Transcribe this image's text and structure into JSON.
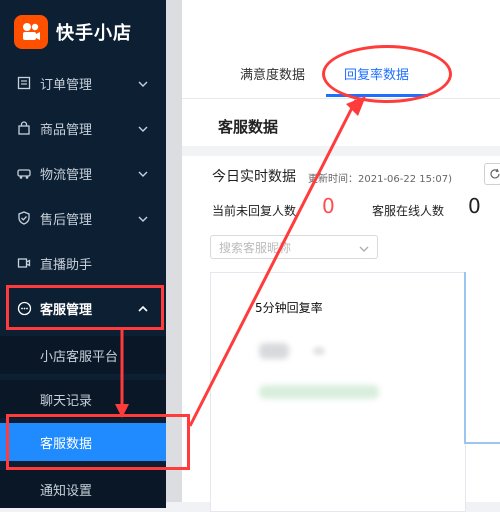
{
  "brand": {
    "name": "快手小店",
    "logo_icon": "kuaishou-logo-icon",
    "accent": "#ff5000"
  },
  "sidebar": {
    "items": [
      {
        "label": "订单管理",
        "icon": "order-list-icon"
      },
      {
        "label": "商品管理",
        "icon": "shopping-bag-icon"
      },
      {
        "label": "物流管理",
        "icon": "truck-icon"
      },
      {
        "label": "售后管理",
        "icon": "shield-check-icon"
      },
      {
        "label": "直播助手",
        "icon": "live-camera-icon"
      },
      {
        "label": "客服管理",
        "icon": "chat-bubble-icon"
      }
    ],
    "sub_items": [
      {
        "label": "小店客服平台"
      },
      {
        "label": "聊天记录"
      },
      {
        "label": "客服数据"
      },
      {
        "label": "通知设置"
      }
    ]
  },
  "tabs": [
    {
      "label": "满意度数据"
    },
    {
      "label": "回复率数据"
    }
  ],
  "section_title": "客服数据",
  "realtime": {
    "title": "今日实时数据",
    "updated": "更新时间：2021-06-22 15:07)"
  },
  "stats": {
    "unreplied_label": "当前未回复人数",
    "unreplied_value": "0",
    "online_label": "客服在线人数",
    "online_value": "0"
  },
  "search": {
    "placeholder": "搜索客服昵称"
  },
  "chart": {
    "title": "5分钟回复率"
  },
  "colors": {
    "sidebar_bg": "#0c1f33",
    "selected": "#1f8bff",
    "annotation": "#ff3b3b",
    "tab_active": "#1f6fff"
  }
}
